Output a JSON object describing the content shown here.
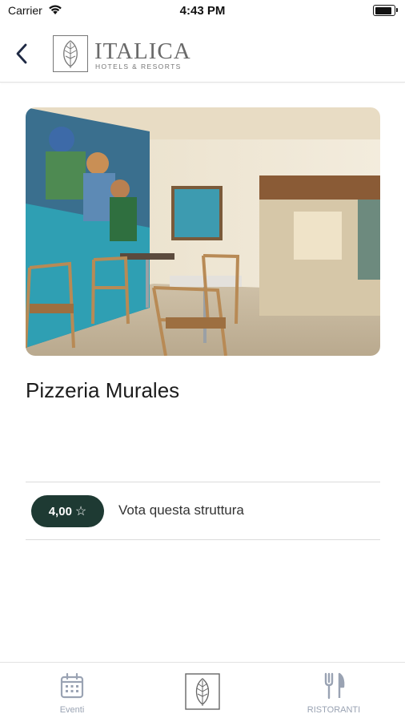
{
  "status_bar": {
    "carrier": "Carrier",
    "time": "4:43 PM"
  },
  "header": {
    "logo_title": "ITALICA",
    "logo_subtitle": "HOTELS & RESORTS",
    "back_icon": "chevron-left-icon"
  },
  "restaurant": {
    "name": "Pizzeria Murales",
    "rating": "4,00",
    "rating_icon": "☆",
    "rate_label": "Vota questa struttura"
  },
  "tabbar": {
    "events_label": "Eventi",
    "home_icon": "italica-leaf-logo",
    "restaurants_label": "RISTORANTI"
  },
  "colors": {
    "accent": "#1e3a33",
    "tab_inactive": "#9aa3b3",
    "divider": "#dcdcdc"
  }
}
